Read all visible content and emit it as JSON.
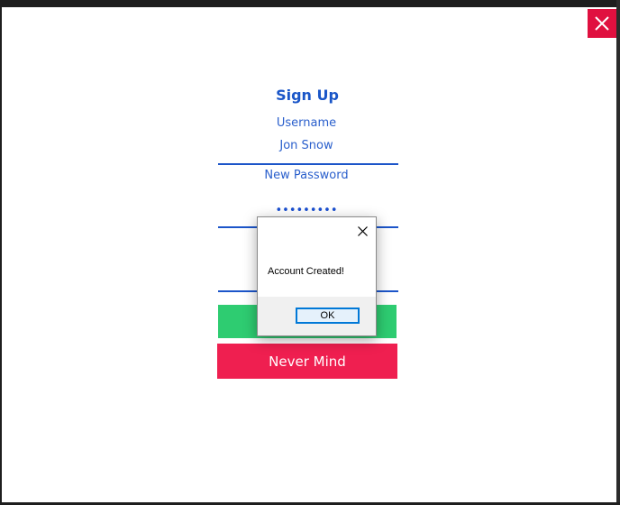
{
  "form": {
    "title": "Sign Up",
    "username_label": "Username",
    "username_value": "Jon Snow",
    "password_label": "New Password",
    "password_value": "•••••••••",
    "cancel_label": "Never Mind"
  },
  "message_box": {
    "text": "Account Created!",
    "ok_label": "OK"
  },
  "colors": {
    "accent_blue": "#1a56c8",
    "close_red": "#e0103f",
    "submit_green": "#2ecc71",
    "cancel_red": "#ef1f50"
  },
  "icons": {
    "window_close": "close-icon",
    "dialog_close": "close-icon"
  }
}
